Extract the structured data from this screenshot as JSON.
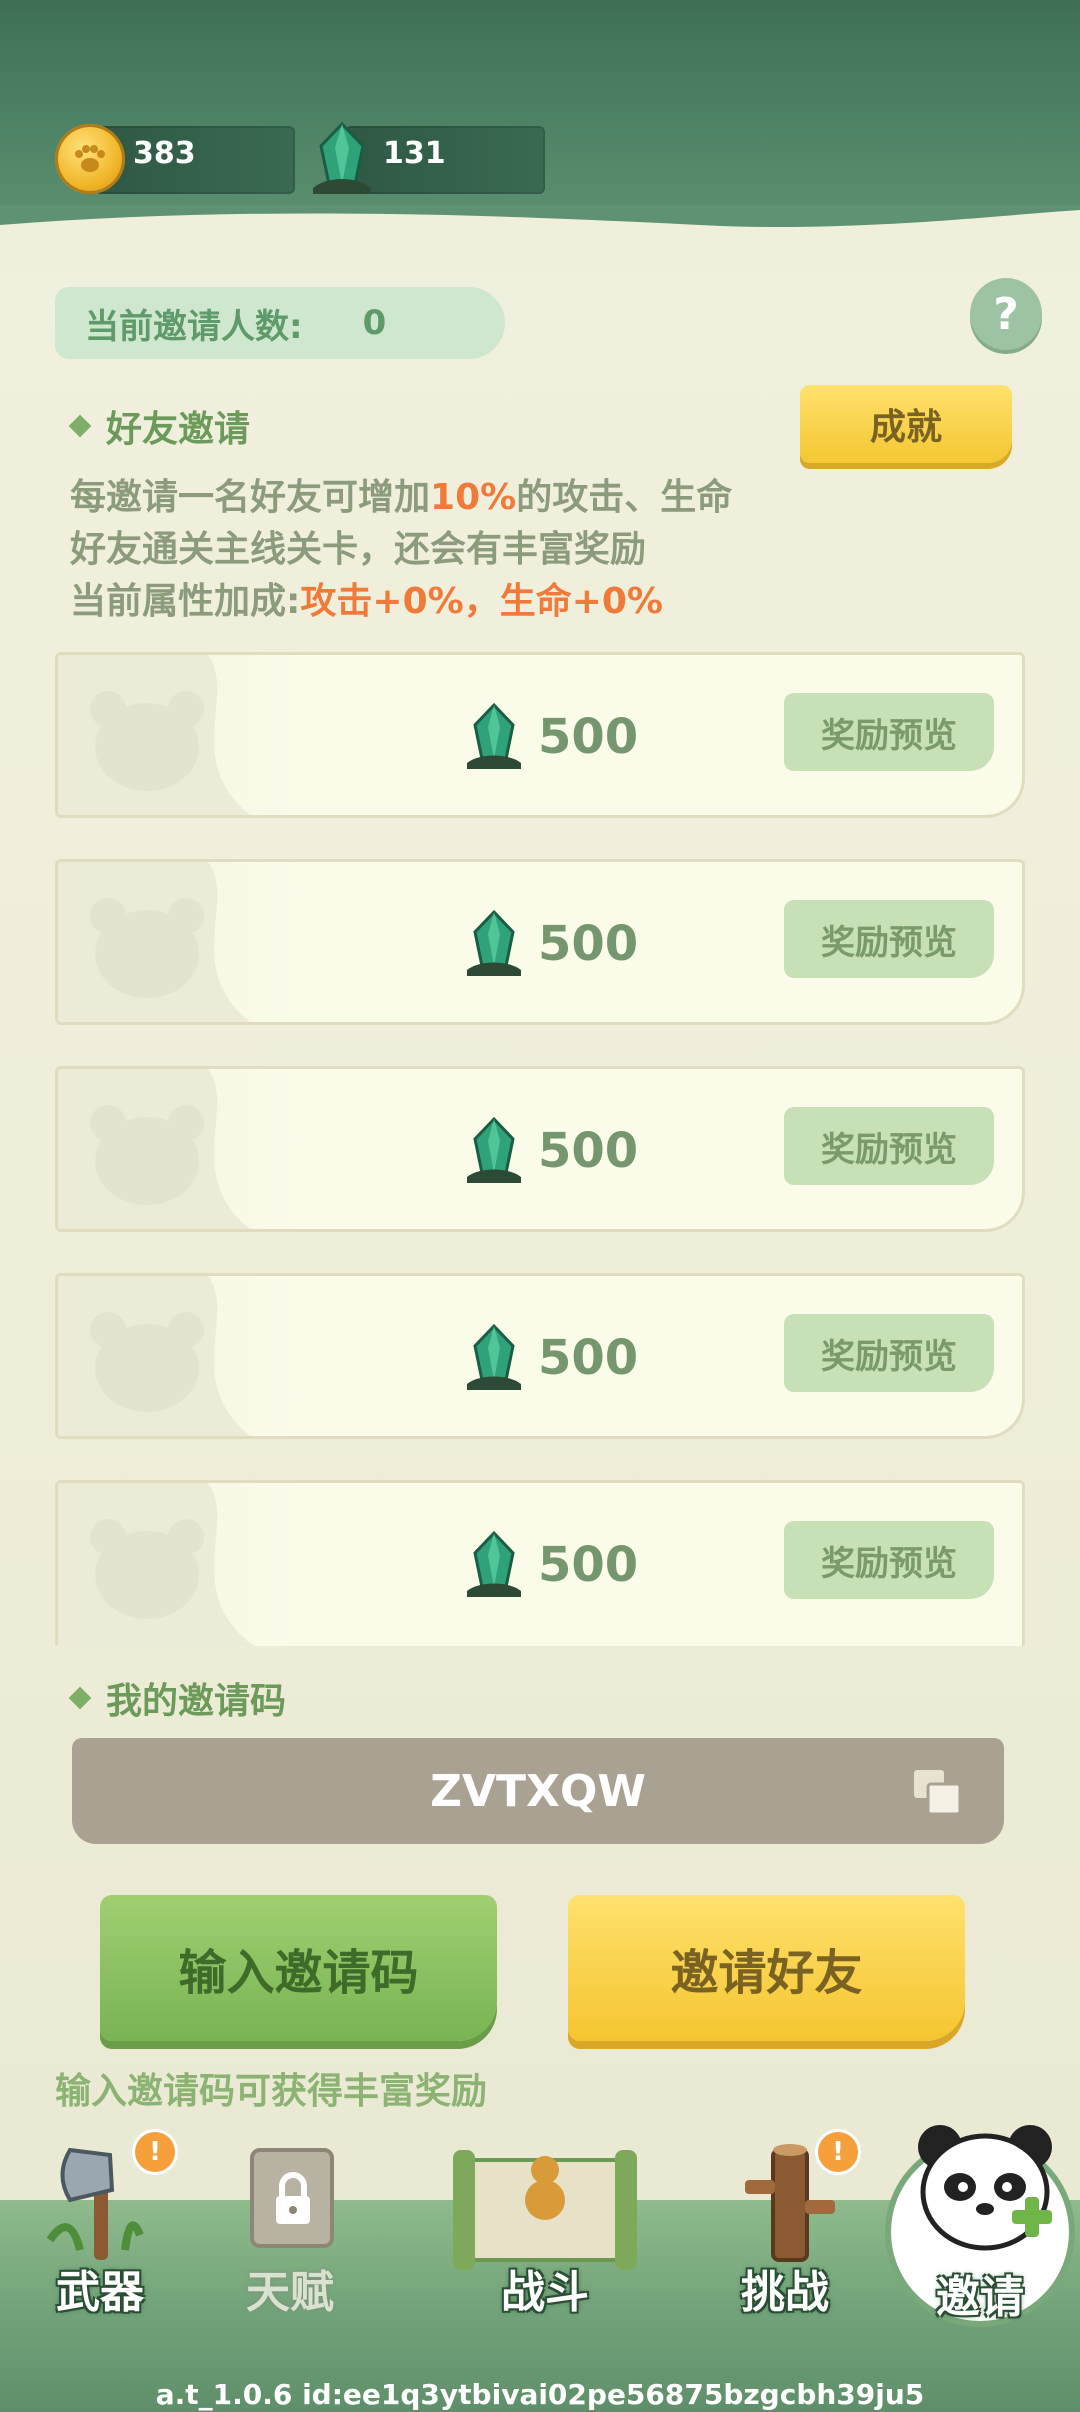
{
  "resources": {
    "coins": "383",
    "gems": "131"
  },
  "invite": {
    "count_label": "当前邀请人数:",
    "count_value": "0",
    "help": "?"
  },
  "friend_invite": {
    "title": "好友邀请",
    "achievement_button": "成就",
    "desc_line1_pre": "每邀请一名好友可增加",
    "desc_line1_hl": "10%",
    "desc_line1_post": "的攻击、生命",
    "desc_line2": "好友通关主线关卡，还会有丰富奖励",
    "desc_line3_pre": "当前属性加成:",
    "desc_line3_hl": "攻击+0%，生命+0%"
  },
  "reward_cards": [
    {
      "amount": "500",
      "button": "奖励预览"
    },
    {
      "amount": "500",
      "button": "奖励预览"
    },
    {
      "amount": "500",
      "button": "奖励预览"
    },
    {
      "amount": "500",
      "button": "奖励预览"
    },
    {
      "amount": "500",
      "button": "奖励预览"
    }
  ],
  "invite_code": {
    "title": "我的邀请码",
    "code": "ZVTXQW"
  },
  "actions": {
    "enter_code": "输入邀请码",
    "invite_friend": "邀请好友",
    "hint": "输入邀请码可获得丰富奖励"
  },
  "nav": {
    "weapon": "武器",
    "talent": "天赋",
    "battle": "战斗",
    "challenge": "挑战",
    "invite": "邀请",
    "badge": "!"
  },
  "footer": {
    "id_text": "a.t_1.0.6 id:ee1q3ytbivai02pe56875bzgcbh39ju5"
  },
  "colors": {
    "header_green": "#4f8566",
    "accent_orange": "#f07a3a",
    "button_green": "#79b452",
    "button_yellow": "#f5c530"
  }
}
